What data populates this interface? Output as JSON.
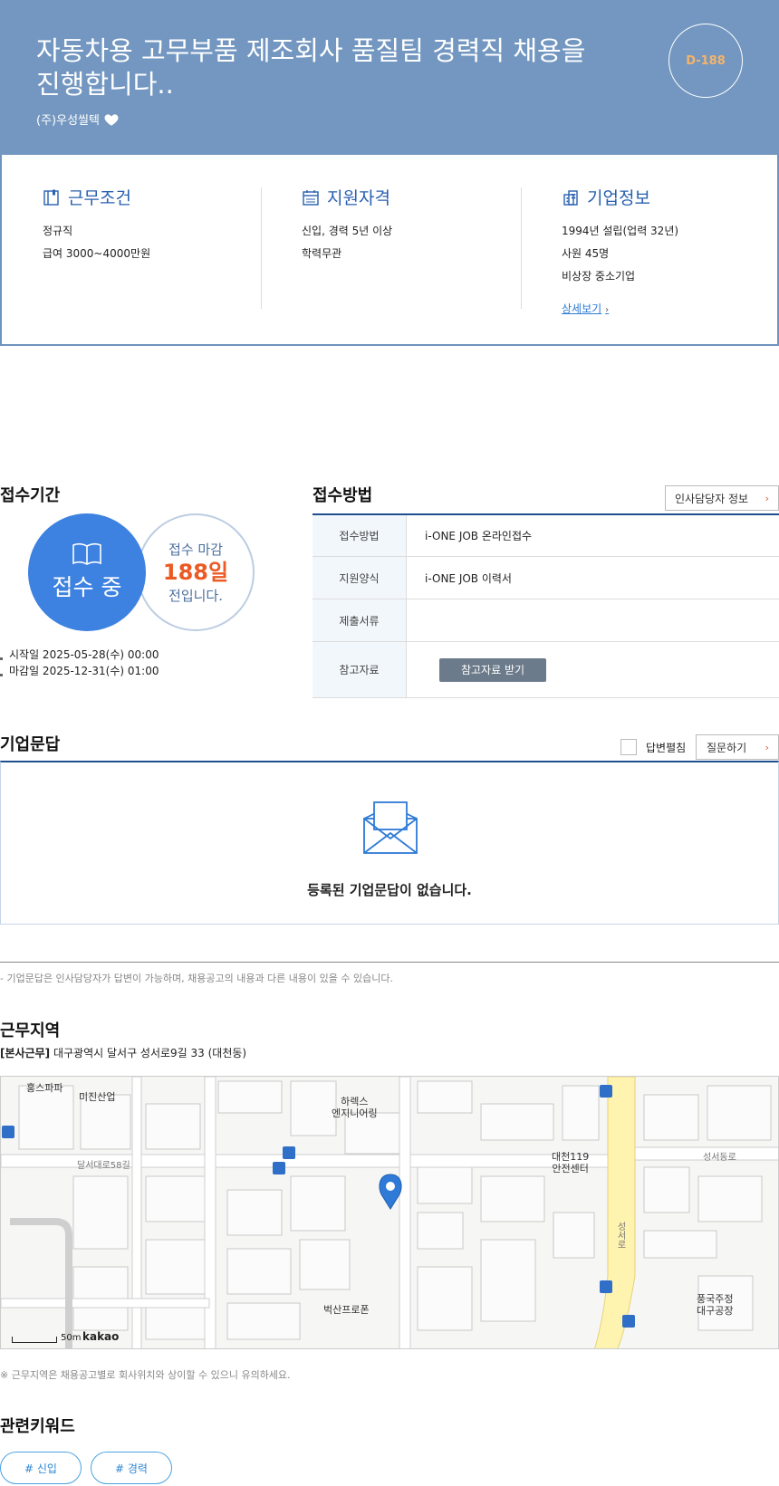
{
  "header": {
    "title": "자동차용 고무부품 제조회사 품질팀 경력직 채용을 진행합니다..",
    "company": "(주)우성씰텍",
    "dday": "D-188",
    "colors": {
      "banner": "#7397c0",
      "dday_text": "#f5b46b"
    }
  },
  "info": {
    "conditions": {
      "title": "근무조건",
      "icon": "book-icon",
      "lines": [
        "정규직",
        "급여 3000~4000만원"
      ]
    },
    "qualifications": {
      "title": "지원자격",
      "icon": "calendar-icon",
      "lines": [
        "신입, 경력 5년 이상",
        "학력무관"
      ]
    },
    "company": {
      "title": "기업정보",
      "icon": "building-icon",
      "lines": [
        "1994년 설립(업력 32년)",
        "사원 45명",
        "비상장 중소기업"
      ],
      "detail_link": "상세보기"
    }
  },
  "reception_period": {
    "title": "접수기간",
    "status": "접수 중",
    "deadline_prefix": "접수 마감",
    "days_left": "188일",
    "deadline_suffix": "전입니다.",
    "start": "시작일 2025-05-28(수) 00:00",
    "end": "마감일 2025-12-31(수) 01:00"
  },
  "reception_method": {
    "title": "접수방법",
    "hr_button": "인사담당자 정보",
    "rows": [
      {
        "key": "접수방법",
        "value": "i-ONE JOB 온라인접수"
      },
      {
        "key": "지원양식",
        "value": "i-ONE JOB 이력서"
      },
      {
        "key": "제출서류",
        "value": ""
      },
      {
        "key": "참고자료",
        "button": "참고자료 받기"
      }
    ]
  },
  "company_qa": {
    "title": "기업문답",
    "toggle_label": "답변펼침",
    "ask_button": "질문하기",
    "empty_message": "등록된 기업문답이 없습니다.",
    "note": "- 기업문답은 인사담당자가 답변이 가능하며, 채용공고의 내용과 다른 내용이 있을 수 있습니다."
  },
  "work_location": {
    "title": "근무지역",
    "tag": "[본사근무]",
    "address": "대구광역시 달서구 성서로9길 33 (대천동)",
    "map": {
      "places": [
        "홍스파파",
        "미진산업",
        "하렉스\n엔지니어링",
        "대천119\n안전센터",
        "벅산프로폰",
        "풍국주정\n대구공장"
      ],
      "roads": [
        "달서대로58길",
        "성서동로",
        "성서로"
      ],
      "scale": "50m",
      "brand": "kakao"
    },
    "note": "※ 근무지역은 채용공고별로 회사위치와 상이할 수 있으니 유의하세요."
  },
  "keywords": {
    "title": "관련키워드",
    "items": [
      "# 신입",
      "# 경력"
    ]
  }
}
